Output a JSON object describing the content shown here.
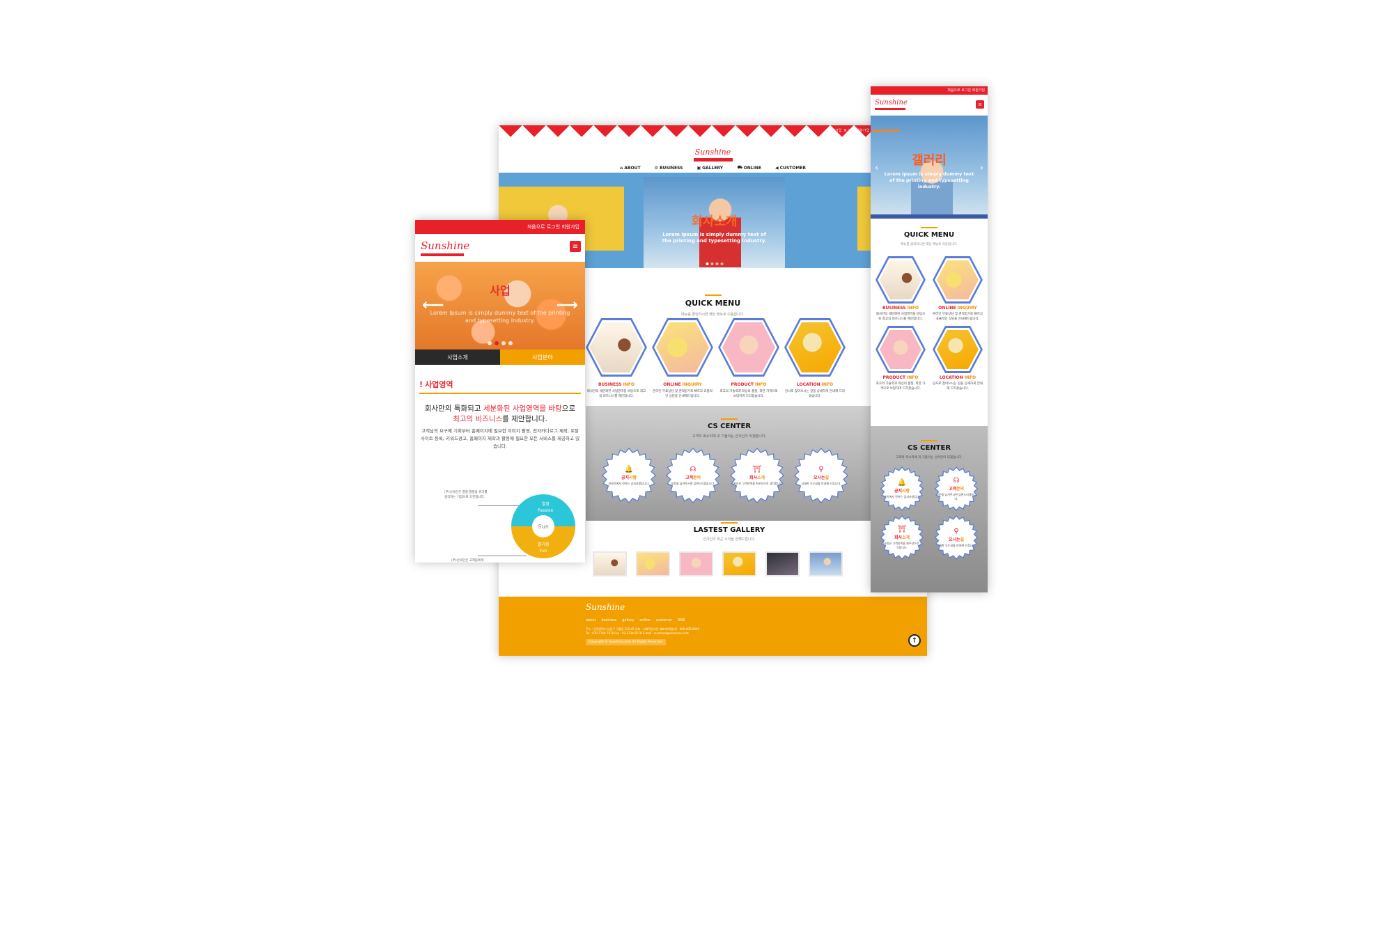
{
  "colors": {
    "primary": "#e8202a",
    "accent": "#f2a000",
    "hex_border": "#5a7ed8"
  },
  "brand": {
    "logo": "Sunshine"
  },
  "desktop": {
    "utility": "회원가입  로그인  회원가입",
    "nav": [
      {
        "icon": "home-icon",
        "label": "ABOUT"
      },
      {
        "icon": "gear-icon",
        "label": "BUSINESS"
      },
      {
        "icon": "image-icon",
        "label": "GALLERY"
      },
      {
        "icon": "cart-icon",
        "label": "ONLINE"
      },
      {
        "icon": "speaker-icon",
        "label": "CUSTOMER"
      }
    ],
    "hero": {
      "title": "회사소개",
      "text1": "Lorem Ipsum is simply dummy text of",
      "text2": "the printing and typesetting industry."
    },
    "quick": {
      "title": "QUICK MENU",
      "subtitle": "메뉴를 클릭하시면 해당 메뉴로 이동합니다.",
      "items": [
        {
          "title_a": "BUSINESS ",
          "title_b": "INFO",
          "desc": "회사만의 세분화된 사업영역을 바탕으로 최고의 비즈니스를 제안합니다."
        },
        {
          "title_a": "ONLINE ",
          "title_b": "INQUIRY",
          "desc": "온라인 무료상담 및 견적받기로 빠르고 효율적인 상담을 안내해드립니다."
        },
        {
          "title_a": "PRODUCT ",
          "title_b": "INFO",
          "desc": "최고의 기술력과 최상의 품질, 착한 가격으로 보답하며 드리겠습니다."
        },
        {
          "title_a": "LOCATION ",
          "title_b": "INFO",
          "desc": "당사로 찾아오시는 길을 상세하게 안내해 드리겠습니다."
        }
      ]
    },
    "cs": {
      "title": "CS CENTER",
      "subtitle": "고객의 목소리에 귀 기울이는 선샤인이 되겠습니다.",
      "items": [
        {
          "icon": "bell-icon",
          "title_a": "공지",
          "title_b": "사항",
          "desc": "선샤인에서 전하는 공지사항입니다."
        },
        {
          "icon": "ear-icon",
          "title_a": "고객",
          "title_b": "문의",
          "desc": "일문을 남겨주시면 답변드리겠습니다."
        },
        {
          "icon": "building-icon",
          "title_a": "회사",
          "title_b": "소개",
          "desc": "선샤인은 고객만족을 최우선으로 생각합니다."
        },
        {
          "icon": "pin-icon",
          "title_a": "오시는",
          "title_b": "길",
          "desc": "상세한 오는길을 안내해 드립니다."
        }
      ]
    },
    "gallery": {
      "title": "LASTEST GALLERY",
      "subtitle": "선샤인의 최근 소식을 전해드립니다."
    },
    "footer": {
      "links": [
        "about",
        "business",
        "gallery",
        "online",
        "customer",
        "SNS"
      ],
      "addr1": "주소 : 인천광역시 남동구 구월동 123-45   상호 : 사회적선샤인   대표자(책임자) : 000-000-0000",
      "addr2": "Tel : 070-7700-7970   Fax : 02-1234-5678   E-mail : sunshine@sunshine.com",
      "copyright": "Copyright © Sunshine.com All Rights Reserved."
    }
  },
  "mobile_left": {
    "utility": "처음으로  로그인  회원가입",
    "hero": {
      "title": "사업",
      "text": "Lorem Ipsum is simply dummy text of the printing and typesetting industry."
    },
    "tabs": [
      "사업소개",
      "사업분야"
    ],
    "section_title": "사업영역",
    "lead_1a": "회사만의 특화되고 ",
    "lead_1b": "세분화된 사업영역을 바탕",
    "lead_1c": "으로",
    "lead_2a": "최고의 비즈니스",
    "lead_2b": "를 제안합니다.",
    "body": "고객님의 요구에 기획부터 홈페이지에 필요한 이미지 촬영, 전자카다로그 제작, 포탈사이트 등록, 키워드광고, 홈페이지 제작과 활용에 필요한 모든 서비스를 제공하고 있습니다.",
    "diagram": {
      "note1a": "(주)선샤인은 열정 열정을 위기를",
      "note1b": "생각하는 기업으로 도전합니다.",
      "note2": "(주)선샤인은 고객들에게",
      "seg1_ko": "열정",
      "seg1_en": "Passion",
      "seg2_ko": "즐거움",
      "seg2_en": "Fun",
      "hub": "Sun"
    }
  },
  "mobile_right": {
    "utility": "처음으로  로그인  회원가입",
    "hero": {
      "title": "갤러리",
      "text": "Lorem Ipsum is simply dummy text of the printing and typesetting industry."
    },
    "quick": {
      "title": "QUICK MENU",
      "subtitle": "메뉴를 클릭하시면 해당 메뉴로 이동합니다.",
      "items": [
        {
          "title_a": "BUSINESS ",
          "title_b": "INFO",
          "desc": "회사만의 세분화된 사업영역을 바탕으로 최고의 비즈니스를 제안합니다."
        },
        {
          "title_a": "ONLINE ",
          "title_b": "INQUIRY",
          "desc": "온라인 무료상담 및 견적받기로 빠르고 효율적인 상담을 안내해드립니다."
        },
        {
          "title_a": "PRODUCT ",
          "title_b": "INFO",
          "desc": "최고의 기술력과 최상의 품질, 착한 가격으로 보답하며 드리겠습니다."
        },
        {
          "title_a": "LOCATION ",
          "title_b": "INFO",
          "desc": "당사로 찾아오시는 길을 상세하게 안내해 드리겠습니다."
        }
      ]
    },
    "cs": {
      "title": "CS CENTER",
      "subtitle": "고객의 목소리에 귀 기울이는 선샤인이 되겠습니다.",
      "items": [
        {
          "icon": "bell-icon",
          "title_a": "공지",
          "title_b": "사항",
          "desc": "선샤인에서 전하는 공지사항입니다."
        },
        {
          "icon": "ear-icon",
          "title_a": "고객",
          "title_b": "문의",
          "desc": "일문을 남겨주시면 답변드리겠습니다."
        },
        {
          "icon": "building-icon",
          "title_a": "회사",
          "title_b": "소개",
          "desc": "선샤인은 고객만족을 최우선으로 생각합니다."
        },
        {
          "icon": "pin-icon",
          "title_a": "오시는",
          "title_b": "길",
          "desc": "상세한 오는길을 안내해 드립니다."
        }
      ]
    }
  }
}
